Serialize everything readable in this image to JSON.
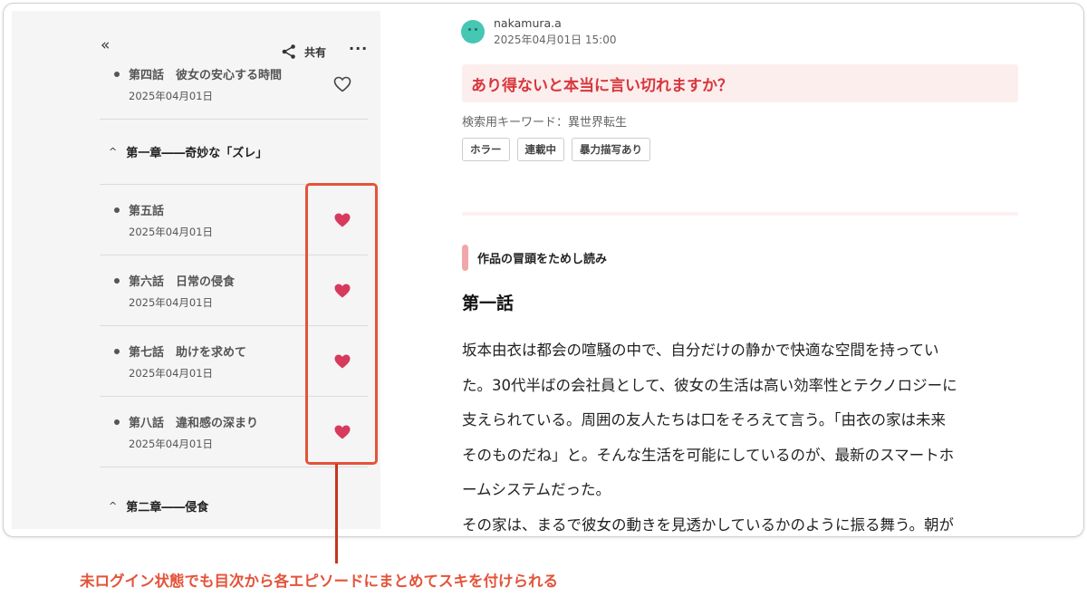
{
  "sidebar": {
    "collapse_label": "«",
    "share_label": "共有",
    "more_label": "···",
    "episodes_top": [
      {
        "title": "第四話　彼女の安心する時間",
        "date": "2025年04月01日",
        "liked": false
      }
    ],
    "chapters": [
      {
        "title": "第一章――奇妙な「ズレ」",
        "episodes": [
          {
            "title": "第五話",
            "date": "2025年04月01日",
            "liked": true
          },
          {
            "title": "第六話　日常の侵食",
            "date": "2025年04月01日",
            "liked": true
          },
          {
            "title": "第七話　助けを求めて",
            "date": "2025年04月01日",
            "liked": true
          },
          {
            "title": "第八話　違和感の深まり",
            "date": "2025年04月01日",
            "liked": true
          }
        ]
      },
      {
        "title": "第二章――侵食",
        "episodes": []
      }
    ]
  },
  "main": {
    "author_name": "nakamura.a",
    "post_date": "2025年04月01日 15:00",
    "catchphrase": "あり得ないと本当に言い切れますか？",
    "keywords": "検索用キーワード：異世界転生",
    "tags": [
      "ホラー",
      "連載中",
      "暴力描写あり"
    ],
    "trial_label": "作品の冒頭をためし読み",
    "episode_heading": "第一話",
    "body_lines": [
      "坂本由衣は都会の喧騒の中で、自分だけの静かで快適な空間を持ってい",
      "た。30代半ばの会社員として、彼女の生活は高い効率性とテクノロジーに",
      "支えられている。周囲の友人たちは口をそろえて言う。「由衣の家は未来",
      "そのものだね」と。そんな生活を可能にしているのが、最新のスマートホ",
      "ームシステムだった。",
      "その家は、まるで彼女の動きを見透かしているかのように振る舞う。朝が"
    ]
  },
  "annotation": "未ログイン状態でも目次から各エピソードにまとめてスキを付けられる",
  "colors": {
    "accent": "#e4533a",
    "heart": "#d73a5c",
    "catch_text": "#d8363b",
    "catch_bg": "#fdeeee",
    "avatar": "#45c7b3"
  }
}
